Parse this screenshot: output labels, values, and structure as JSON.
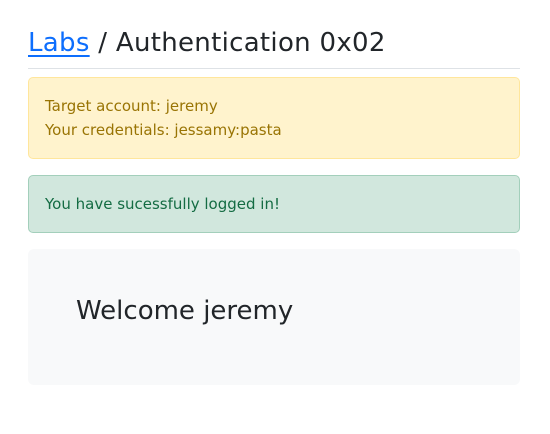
{
  "header": {
    "breadcrumb_link": "Labs",
    "separator": " / ",
    "page_title": "Authentication 0x02"
  },
  "info_alert": {
    "target_account": "Target account: jeremy",
    "credentials": "Your credentials: jessamy:pasta"
  },
  "success_alert": {
    "message": "You have sucessfully logged in!"
  },
  "welcome": {
    "text": "Welcome jeremy"
  },
  "colors": {
    "link": "#0d6efd",
    "warning_bg": "#fff3cd",
    "warning_text": "#997404",
    "success_bg": "#d1e7dd",
    "success_text": "#146c43",
    "panel_bg": "#f8f9fa"
  }
}
